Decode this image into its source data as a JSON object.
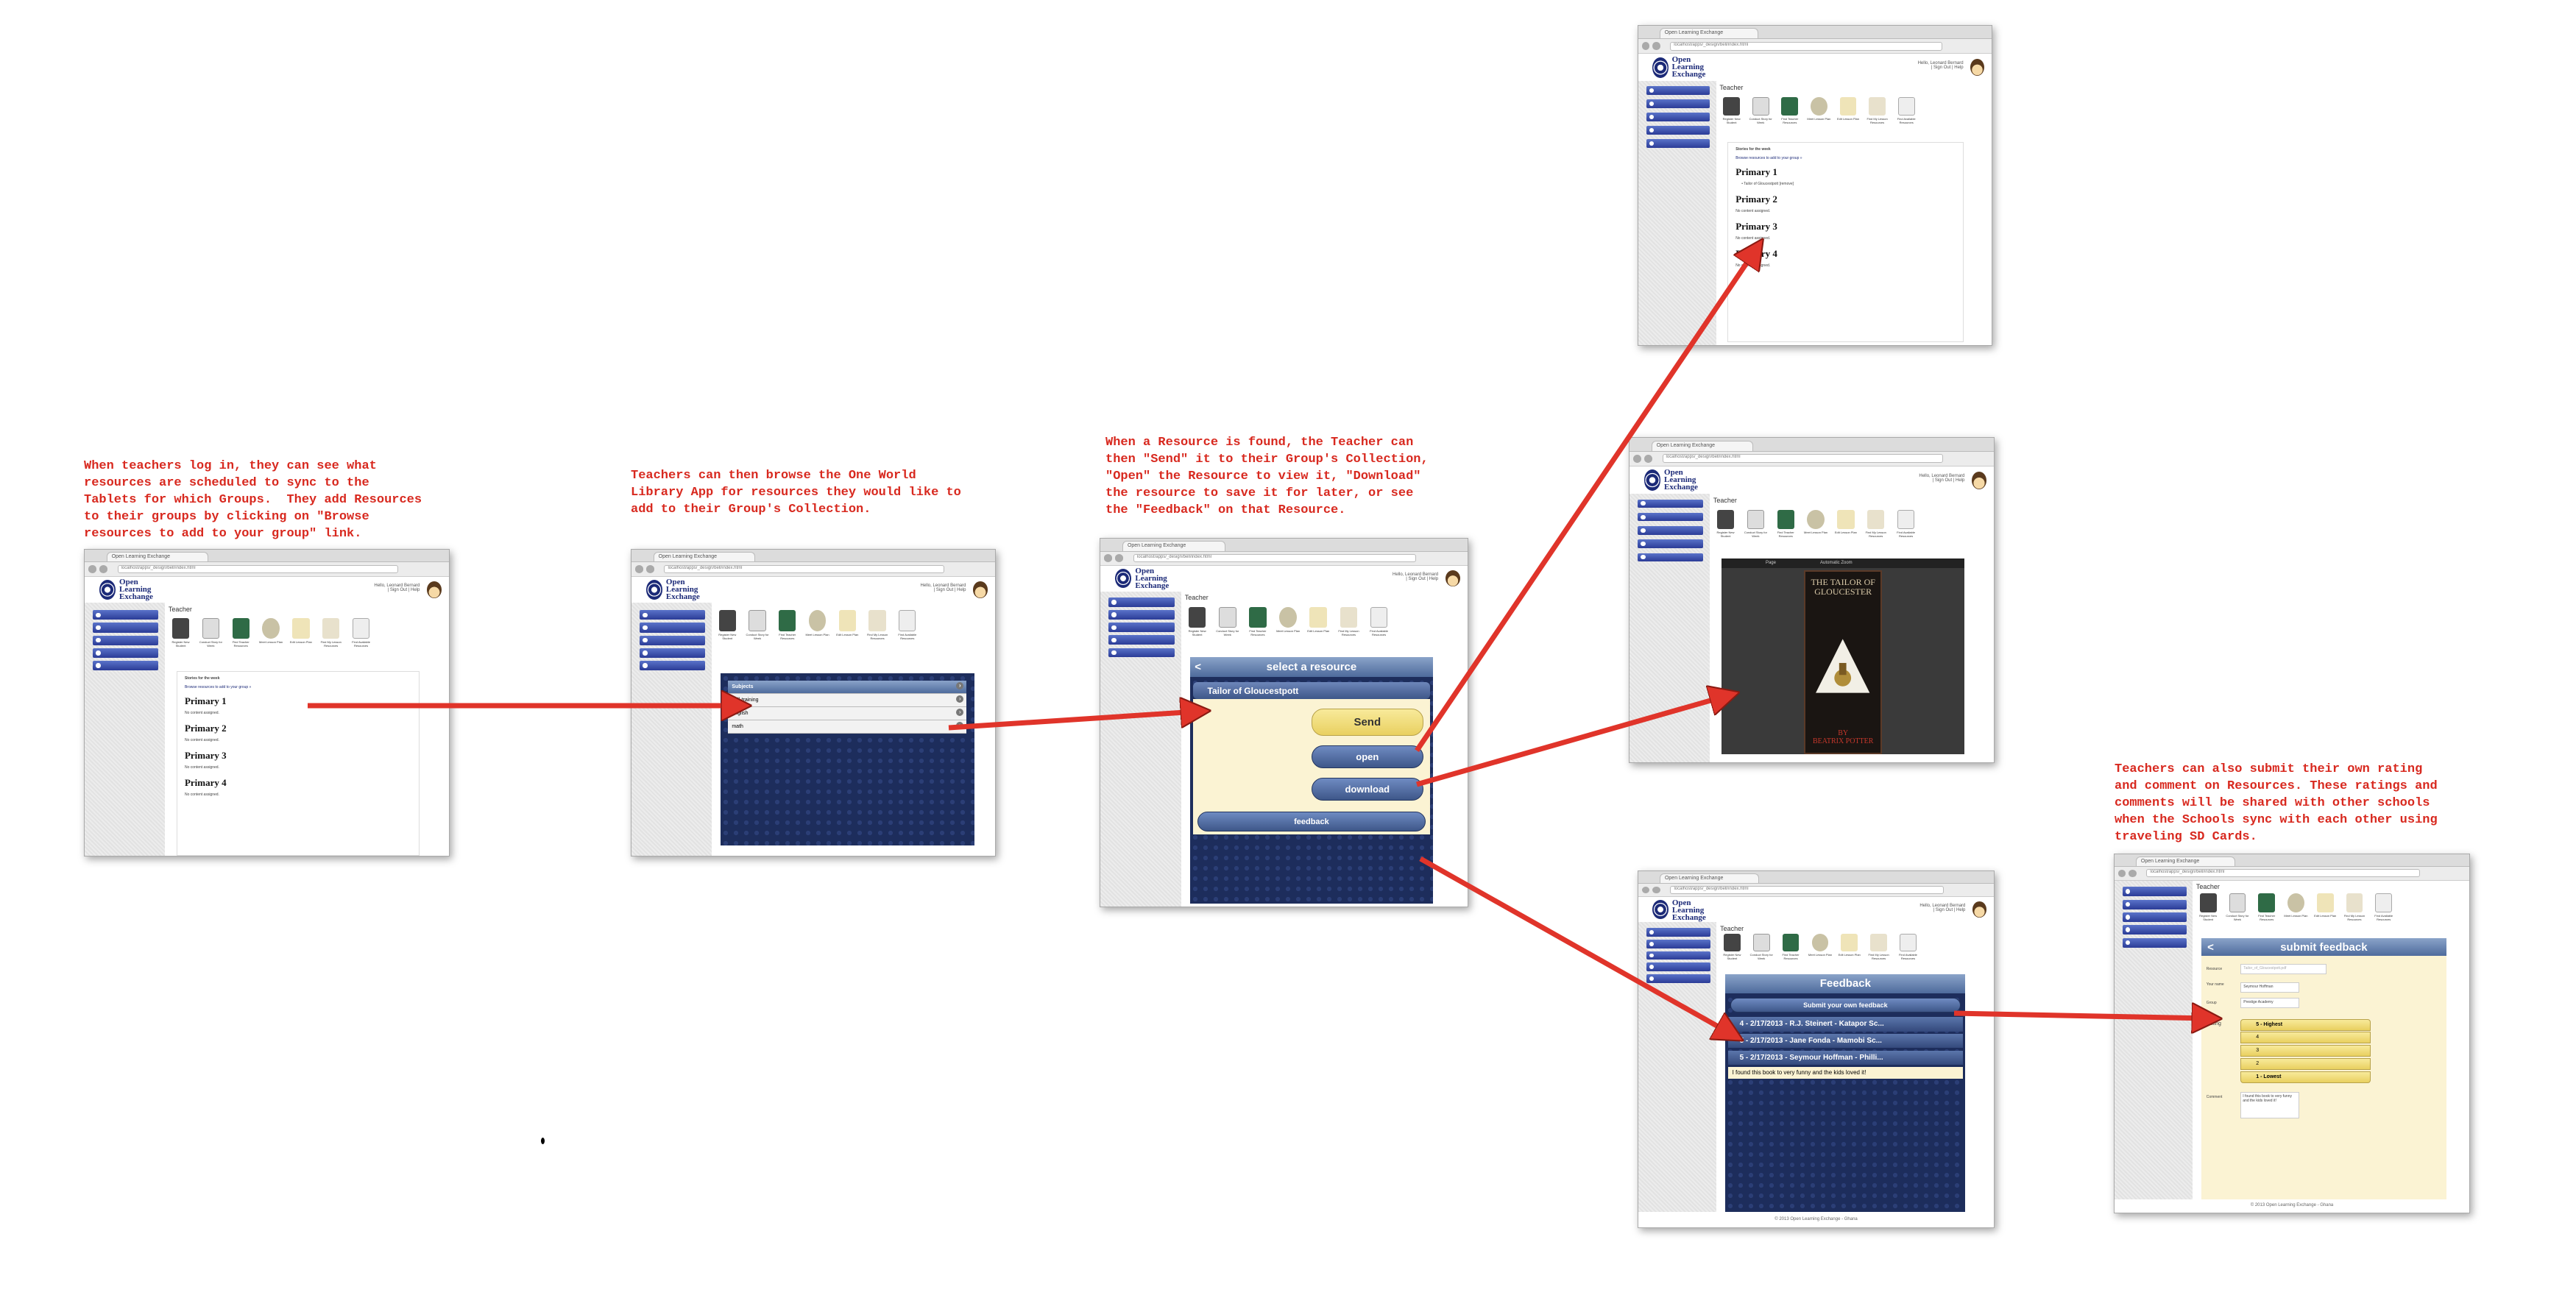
{
  "notes": {
    "login": "When teachers log in, they can see what\nresources are scheduled to sync to the\nTablets for which Groups.  They add Resources\nto their groups by clicking on \"Browse\nresources to add to your group\" link.",
    "browse": "Teachers can then browse the One World\nLibrary App for resources they would like to\nadd to their Group's Collection.",
    "found": "When a Resource is found, the Teacher can\nthen \"Send\" it to their Group's Collection,\n\"Open\" the Resource to view it, \"Download\"\nthe resource to save it for later, or see\nthe \"Feedback\" on that Resource.",
    "rating": "Teachers can also submit their own rating\nand comment on Resources. These ratings and\ncomments will be shared with other schools\nwhen the Schools sync with each other using\ntraveling SD Cards."
  },
  "browser": {
    "tab": "Open Learning Exchange",
    "url": "localhost/apps/_design/bell/index.html",
    "logo": "Open\nLearning\nExchange",
    "hello": "Hello, Leonard Bernard\n| Sign Out | Help",
    "page_title": "Teacher",
    "footer": "© 2013 Open Learning Exchange - Ghana"
  },
  "icon_labels": [
    "Register New Student",
    "Conduct Story for Week",
    "Find Teacher Resources",
    "Meet Lesson Plan",
    "Edit Lesson Plan",
    "Find My Lesson Resources",
    "Find Available Resources"
  ],
  "dashboard": {
    "stories": "Stories for the week",
    "browse_link": "Browse resources to add to your group »",
    "groups": [
      "Primary 1",
      "Primary 2",
      "Primary 3",
      "Primary 4"
    ],
    "empty": "No content assigned.",
    "assigned": "• Tailor of Gloucestpott [remove]"
  },
  "subjects": {
    "header": "Subjects",
    "items": [
      "bell-training",
      "english",
      "math"
    ]
  },
  "resource": {
    "title": "select a resource",
    "back": "<",
    "name": "Tailor of Gloucestpott",
    "send": "Send",
    "open": "open",
    "download": "download",
    "feedback": "feedback"
  },
  "viewer": {
    "page": "Page",
    "zoom": "Automatic Zoom",
    "book_title": "THE TAILOR OF\nGLOUCESTER",
    "author": "BY\nBEATRIX POTTER"
  },
  "feedback_list": {
    "title": "Feedback",
    "submit": "Submit your own feedback",
    "entries": [
      "4 - 2/17/2013 - R.J. Steinert - Katapor Sc...",
      "5 - 2/17/2013 - Jane Fonda - Mamobi Sc...",
      "5 - 2/17/2013 - Seymour Hoffman - Philli..."
    ],
    "comment": "I found this book to very funny and the kids loved it!"
  },
  "submit_form": {
    "title": "submit feedback",
    "back": "<",
    "resource_label": "Resource",
    "resource_value": "Tailor_of_Gloucestpott.pdf",
    "name_label": "Your name",
    "name_value": "Seymour Hoffman",
    "group_label": "Group",
    "group_value": "Prestige Academy",
    "rating_label": "Rating",
    "ratings": [
      "5 - Highest",
      "4",
      "3",
      "2",
      "1 - Lowest"
    ],
    "comment_label": "Comment",
    "comment_value": "I found this book to very funny and the kids loved it!"
  },
  "colors": {
    "note": "#d8291f",
    "arrow": "#e0342a"
  }
}
